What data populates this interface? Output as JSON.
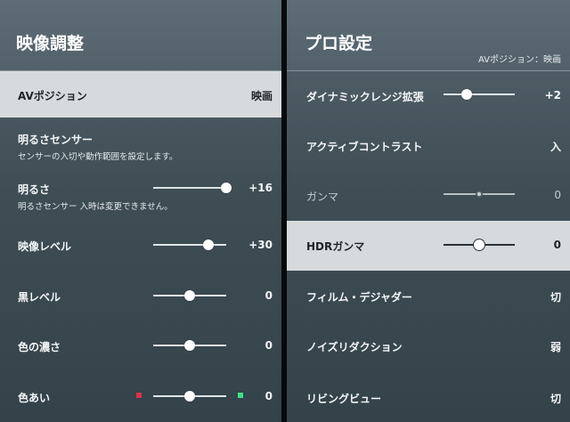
{
  "left": {
    "title": "映像調整",
    "av_position": {
      "label": "AVポジション",
      "value": "映画"
    },
    "brightness_sensor": {
      "label": "明るさセンサー",
      "desc": "センサーの入切や動作範囲を設定します。"
    },
    "sliders": [
      {
        "key": "brightness",
        "label": "明るさ",
        "value": "+16",
        "level": 1.0,
        "note": "明るさセンサー 入時は変更できません。"
      },
      {
        "key": "picture-level",
        "label": "映像レベル",
        "value": "+30",
        "level": 0.75
      },
      {
        "key": "black-level",
        "label": "黒レベル",
        "value": "0",
        "level": 0.5
      },
      {
        "key": "color-depth",
        "label": "色の濃さ",
        "value": "0",
        "level": 0.5
      },
      {
        "key": "hue",
        "label": "色あい",
        "value": "0",
        "level": 0.5,
        "hue_colors": [
          "#e0314a",
          "#3ee08c"
        ]
      }
    ]
  },
  "right": {
    "title": "プロ設定",
    "av_position": "AVポジション：映画",
    "rows": [
      {
        "key": "dynamic-range",
        "label": "ダイナミックレンジ拡張",
        "value": "+2",
        "slider": true,
        "level": 0.33
      },
      {
        "key": "active-contrast",
        "label": "アクティブコントラスト",
        "value": "入",
        "slider": false
      },
      {
        "key": "gamma",
        "label": "ガンマ",
        "value": "0",
        "slider": true,
        "level": 0.5,
        "disabled": true
      },
      {
        "key": "hdr-gamma",
        "label": "HDRガンマ",
        "value": "0",
        "slider": true,
        "level": 0.5,
        "highlight": true
      },
      {
        "key": "film-dejudder",
        "label": "フィルム・デジャダー",
        "value": "切",
        "slider": false
      },
      {
        "key": "noise-reduction",
        "label": "ノイズリダクション",
        "value": "弱",
        "slider": false
      },
      {
        "key": "living-view",
        "label": "リビングビュー",
        "value": "切",
        "slider": false
      }
    ]
  }
}
